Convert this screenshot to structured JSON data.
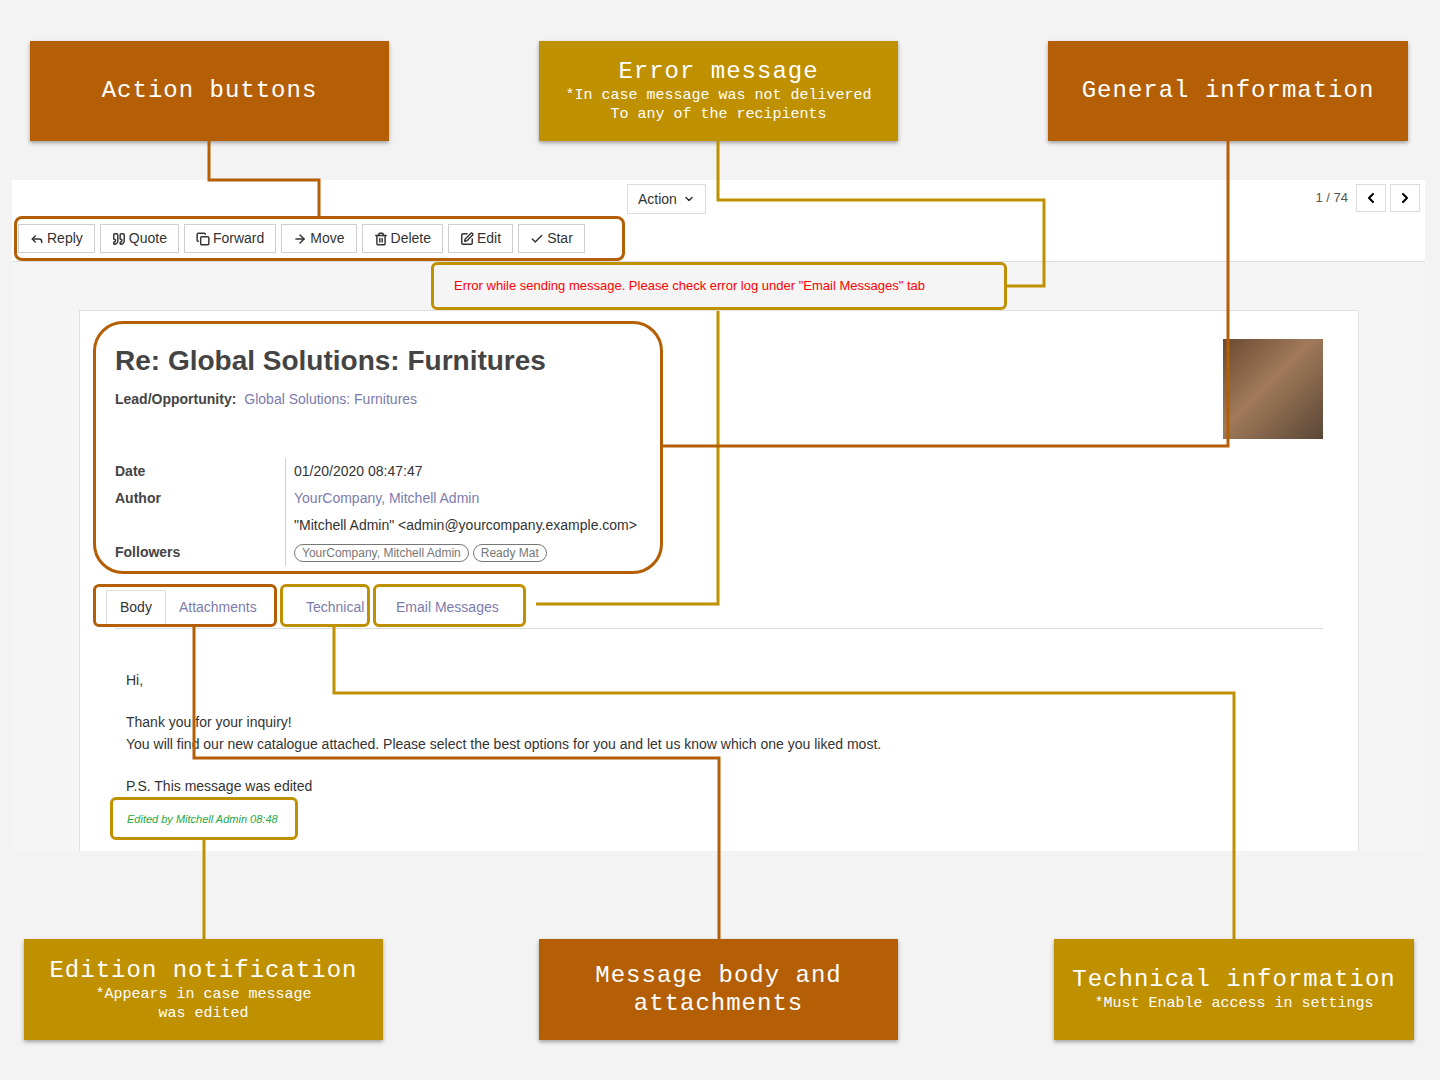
{
  "callouts": {
    "top": [
      {
        "title": "Action buttons",
        "note": [],
        "color": "#b45f06"
      },
      {
        "title": "Error message",
        "note": [
          "*In case message was not delivered",
          "To any of the recipients"
        ],
        "color": "#bf9000"
      },
      {
        "title": "General information",
        "note": [],
        "color": "#b45f06"
      }
    ],
    "bottom": [
      {
        "title": "Edition notification",
        "note": [
          "*Appears in case message",
          "was edited"
        ],
        "color": "#bf9000"
      },
      {
        "title": "Message body and attachments",
        "note": [],
        "color": "#b45f06"
      },
      {
        "title": "Technical information",
        "note": [
          "*Must Enable access in settings"
        ],
        "color": "#bf9000"
      }
    ]
  },
  "control_panel": {
    "action_menu": "Action",
    "pager": "1 / 74"
  },
  "toolbar": {
    "buttons": [
      {
        "label": "Reply"
      },
      {
        "label": "Quote"
      },
      {
        "label": "Forward"
      },
      {
        "label": "Move"
      },
      {
        "label": "Delete"
      },
      {
        "label": "Edit"
      },
      {
        "label": "Star"
      }
    ]
  },
  "error": "Error while sending message. Please check error log under \"Email Messages\" tab",
  "message": {
    "title": "Re: Global Solutions: Furnitures",
    "lead": {
      "label": "Lead/Opportunity:",
      "value": "Global Solutions: Furnitures"
    },
    "fields": [
      {
        "kind": "text",
        "label": "Date",
        "value": "01/20/2020 08:47:47",
        "tags": []
      },
      {
        "kind": "link",
        "label": "Author",
        "value": "YourCompany, Mitchell Admin",
        "tags": []
      },
      {
        "kind": "text",
        "label": "",
        "value": "\"Mitchell Admin\" <admin@yourcompany.example.com>",
        "tags": []
      },
      {
        "kind": "tags",
        "label": "Followers",
        "value": "",
        "tags": [
          "YourCompany, Mitchell Admin",
          "Ready Mat"
        ]
      }
    ]
  },
  "tabs": [
    {
      "label": "Body",
      "selected": true
    },
    {
      "label": "Attachments",
      "selected": false
    },
    {
      "label": "Technical",
      "selected": false
    },
    {
      "label": "Email Messages",
      "selected": false
    }
  ],
  "body": {
    "paragraphs": [
      [
        "Hi,"
      ],
      [
        "Thank you for your inquiry!",
        "You will find our new catalogue attached. Please select the best options for you and let us know which one you liked most."
      ],
      [
        "P.S. This message was edited"
      ]
    ],
    "edit_note": "Edited by Mitchell Admin 08:48"
  }
}
